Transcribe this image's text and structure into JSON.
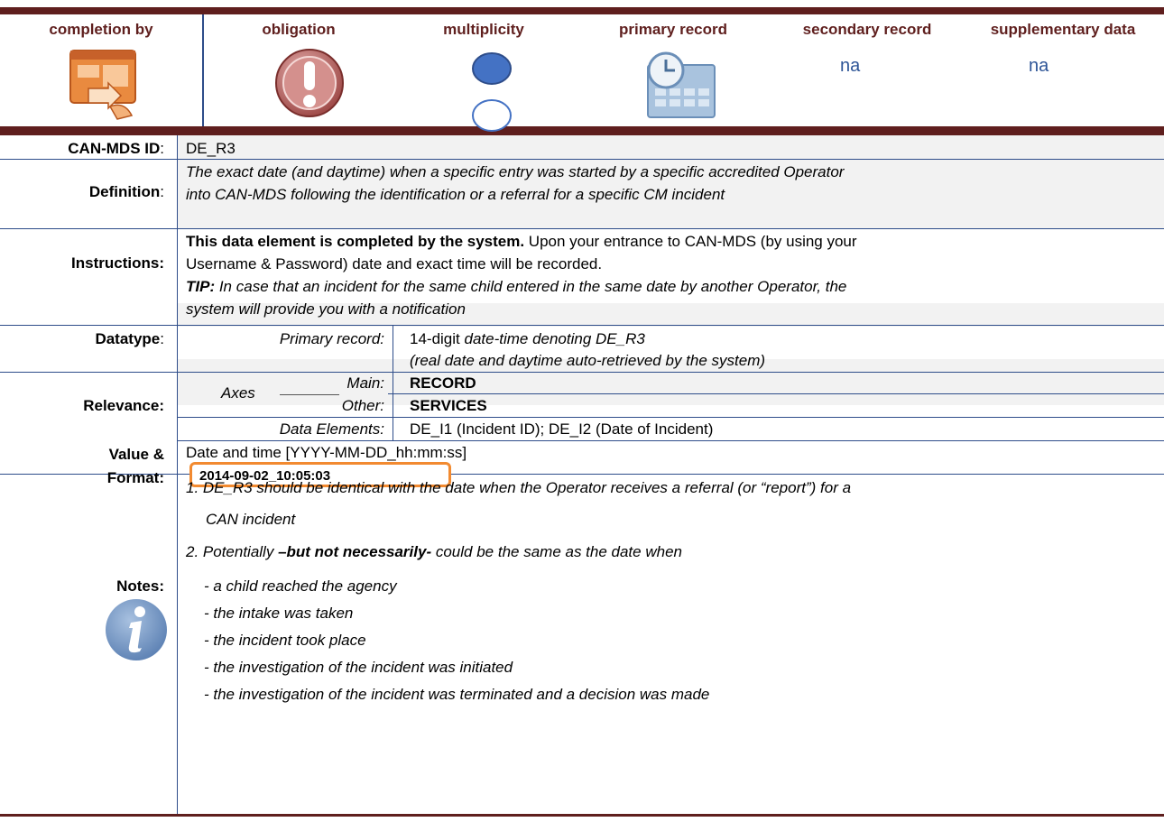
{
  "header": {
    "columns": [
      "completion by",
      "obligation",
      "multiplicity",
      "primary record",
      "secondary record",
      "supplementary data"
    ],
    "secondary_value": "na",
    "supplementary_value": "na"
  },
  "rows": {
    "id": {
      "label": "CAN-MDS ID",
      "colon": ":",
      "value": "DE_R3"
    },
    "definition": {
      "label": "Definition",
      "colon": ":",
      "line1": "The exact date (and daytime) when a specific entry was started by a specific accredited Operator",
      "line2": "into CAN-MDS following the identification or a referral for a specific CM incident"
    },
    "instructions": {
      "label": "Instructions:",
      "bold": "This data element is completed by the system.",
      "line1_rest": " Upon your entrance to CAN-MDS (by using your",
      "line2": "Username & Password) date and exact time will be recorded.",
      "tip": "TIP:",
      "line3_rest": " In case that an incident for the same child entered in the same date by another Operator, the",
      "line4": "system will provide you with a notification"
    },
    "datatype": {
      "label": "Datatype",
      "colon": ":",
      "sub": "Primary record:",
      "v1a": "14-digit ",
      "v1b": "date-time denoting DE_R3",
      "v2": "(real date and daytime auto-retrieved by the system)"
    },
    "relevance": {
      "label": "Relevance:",
      "axes": "Axes",
      "main": "Main:",
      "main_val": "RECORD",
      "other": "Other:",
      "other_val": "SERVICES",
      "de": "Data Elements:",
      "de_val": "DE_I1 (Incident ID); DE_I2 (Date of Incident)"
    },
    "value": {
      "label1": "Value &",
      "label2": "Format:",
      "format": "Date and time  [YYYY-MM-DD_hh:mm:ss]",
      "example": "2014-09-02_10:05:03"
    },
    "notes": {
      "label": "Notes:",
      "n1a": "1. DE_R3 should be identical with the date when the Operator receives a referral (or “report”)  for a",
      "n1b": "CAN incident",
      "n2a": "2. Potentially ",
      "n2b": "–but not necessarily-",
      "n2c": " could be the same as the date when",
      "items": [
        "- a child reached the agency",
        "- the intake was taken",
        "- the incident took place",
        "- the investigation of the incident was initiated",
        "- the investigation of the incident was terminated and a decision was made"
      ]
    }
  },
  "icons": [
    "computer-form-icon",
    "exclamation-icon",
    "multiplicity-icon",
    "calendar-clock-icon",
    "info-icon"
  ],
  "colors": {
    "rule": "#5f1f1e",
    "header_text": "#5f1f1e",
    "na": "#2e5597",
    "grid": "#2e4d8a",
    "example_border": "#f28a30"
  }
}
